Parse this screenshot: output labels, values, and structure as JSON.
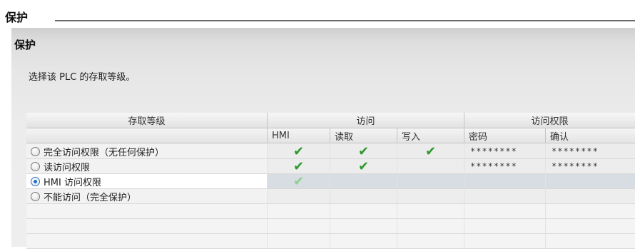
{
  "page": {
    "section_title": "保护"
  },
  "panel": {
    "title": "保护",
    "instruction": "选择该 PLC 的存取等级。"
  },
  "table": {
    "group_headers": [
      "存取等级",
      "访问",
      "访问权限"
    ],
    "sub_headers": [
      "",
      "HMI",
      "读取",
      "写入",
      "密码",
      "确认"
    ],
    "rows": [
      {
        "label": "完全访问权限（无任何保护）",
        "selected": false,
        "hmi": "✔",
        "read": "✔",
        "write": "✔",
        "password": "********",
        "confirm": "********"
      },
      {
        "label": "读访问权限",
        "selected": false,
        "hmi": "✔",
        "read": "✔",
        "write": "",
        "password": "********",
        "confirm": "********"
      },
      {
        "label": "HMI 访问权限",
        "selected": true,
        "hmi": "✔",
        "read": "",
        "write": "",
        "password": "",
        "confirm": ""
      },
      {
        "label": "不能访问（完全保护）",
        "selected": false,
        "hmi": "",
        "read": "",
        "write": "",
        "password": "",
        "confirm": ""
      }
    ]
  },
  "colors": {
    "check": "#2e9a2e",
    "selected_radio": "#1f6fc8"
  }
}
